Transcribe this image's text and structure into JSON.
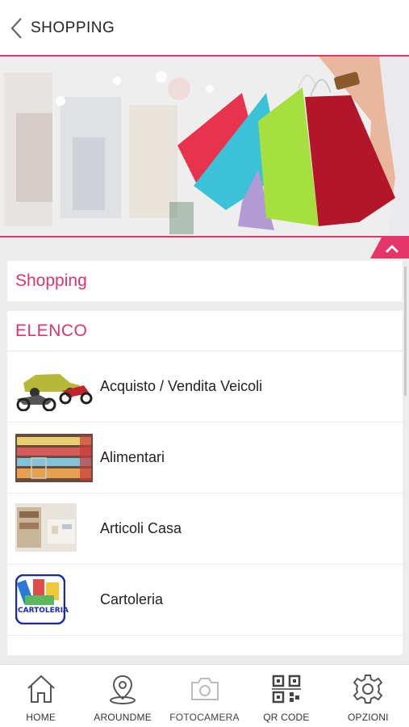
{
  "header": {
    "title": "SHOPPING",
    "back_icon": "chevron-left-icon"
  },
  "hero": {
    "image": "shopping-bags-photo",
    "collapse_icon": "chevron-up-icon"
  },
  "section_title": "Shopping",
  "list": {
    "header": "ELENCO",
    "items": [
      {
        "label": "Acquisto / Vendita Veicoli",
        "thumb": "vehicles-thumb"
      },
      {
        "label": "Alimentari",
        "thumb": "grocery-thumb"
      },
      {
        "label": "Articoli Casa",
        "thumb": "home-goods-thumb"
      },
      {
        "label": "Cartoleria",
        "thumb": "stationery-thumb",
        "thumb_text": "CARTOLERIA"
      }
    ]
  },
  "nav": {
    "items": [
      {
        "label": "HOME",
        "icon": "home-icon"
      },
      {
        "label": "AROUNDME",
        "icon": "map-pin-icon"
      },
      {
        "label": "FOTOCAMERA",
        "icon": "camera-icon"
      },
      {
        "label": "QR CODE",
        "icon": "qr-code-icon"
      },
      {
        "label": "OPZIONI",
        "icon": "gear-icon"
      }
    ]
  },
  "colors": {
    "accent": "#e0336a",
    "background": "#ececec"
  }
}
